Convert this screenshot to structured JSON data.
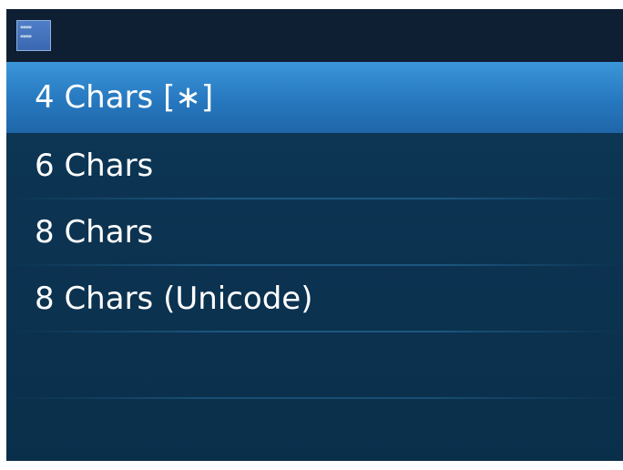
{
  "app": {
    "icon_name": "password-stars-icon",
    "icon_glyph": "****\n****"
  },
  "menu": {
    "items": [
      {
        "label": "4  Chars [∗]",
        "selected": true
      },
      {
        "label": "6  Chars",
        "selected": false
      },
      {
        "label": "8  Chars",
        "selected": false
      },
      {
        "label": "8  Chars (Unicode)",
        "selected": false
      }
    ]
  },
  "colors": {
    "background": "#0c3452",
    "titlebar": "#0f1f33",
    "selection": "#2778bf",
    "text": "#ffffff"
  }
}
